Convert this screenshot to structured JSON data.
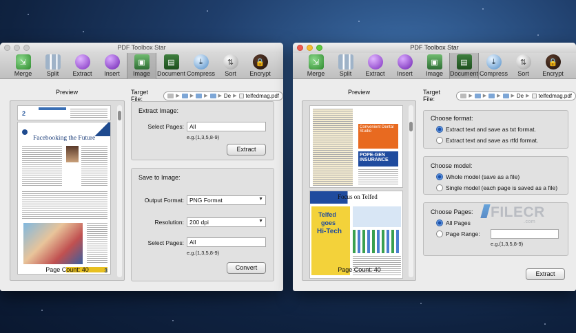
{
  "watermark": {
    "brand": "FILECR",
    "domain": ".com"
  },
  "left_window": {
    "title": "PDF Toolbox Star",
    "toolbar": [
      {
        "label": "Merge",
        "icon": "merge-icon"
      },
      {
        "label": "Split",
        "icon": "split-icon"
      },
      {
        "label": "Extract",
        "icon": "extract-icon"
      },
      {
        "label": "Insert",
        "icon": "insert-icon"
      },
      {
        "label": "Image",
        "icon": "image-icon"
      },
      {
        "label": "Document",
        "icon": "document-icon"
      },
      {
        "label": "Compress",
        "icon": "compress-icon"
      },
      {
        "label": "Sort",
        "icon": "sort-icon"
      },
      {
        "label": "Encrypt",
        "icon": "encrypt-icon"
      }
    ],
    "selected_tool": "Image",
    "preview_label": "Preview",
    "page_count": "Page Count: 40",
    "target_label": "Target File:",
    "target_crumb_short": "De",
    "target_file": "telfedmag.pdf",
    "extract_image": {
      "title": "Extract Image:",
      "select_label": "Select Pages:",
      "select_value": "All",
      "hint": "e.g.(1,3,5,8-9)",
      "button": "Extract"
    },
    "save_image": {
      "title": "Save to Image:",
      "format_label": "Output Format:",
      "format_value": "PNG Format",
      "resolution_label": "Resolution:",
      "resolution_value": "200 dpi",
      "select_label": "Select Pages:",
      "select_value": "All",
      "hint": "e.g.(1,3,5,8-9)",
      "button": "Convert"
    },
    "page_preview": {
      "page_top_number": "2",
      "headline": "Facebooking the Future",
      "page_bottom_number": "3"
    }
  },
  "right_window": {
    "title": "PDF Toolbox Star",
    "toolbar": [
      {
        "label": "Merge",
        "icon": "merge-icon"
      },
      {
        "label": "Split",
        "icon": "split-icon"
      },
      {
        "label": "Extract",
        "icon": "extract-icon"
      },
      {
        "label": "Insert",
        "icon": "insert-icon"
      },
      {
        "label": "Image",
        "icon": "image-icon"
      },
      {
        "label": "Document",
        "icon": "document-icon"
      },
      {
        "label": "Compress",
        "icon": "compress-icon"
      },
      {
        "label": "Sort",
        "icon": "sort-icon"
      },
      {
        "label": "Encrypt",
        "icon": "encrypt-icon"
      }
    ],
    "selected_tool": "Document",
    "preview_label": "Preview",
    "page_count": "Page Count: 40",
    "target_label": "Target File:",
    "target_crumb_short": "De",
    "target_file": "telfedmag.pdf",
    "choose_format": {
      "title": "Choose format:",
      "options": [
        "Extract text and save as txt format.",
        "Extract text and save as rtfd format."
      ],
      "selected": 0
    },
    "choose_model": {
      "title": "Choose model:",
      "options": [
        "Whole model (save as a file)",
        "Single model (each page is saved as a file)"
      ],
      "selected": 0
    },
    "choose_pages": {
      "title": "Choose Pages:",
      "all_label": "All Pages",
      "range_label": "Page Range:",
      "range_value": "",
      "hint": "e.g.(1,3,5,8-9)",
      "selected": "all"
    },
    "button": "Extract",
    "page_preview": {
      "ad1": "Convenient Dental Studio",
      "ad2": "POPE-GEN INSURANCE",
      "headline": "Focus on Telfed",
      "side_text": [
        "Telfed",
        "goes",
        "Hi-Tech"
      ]
    }
  }
}
